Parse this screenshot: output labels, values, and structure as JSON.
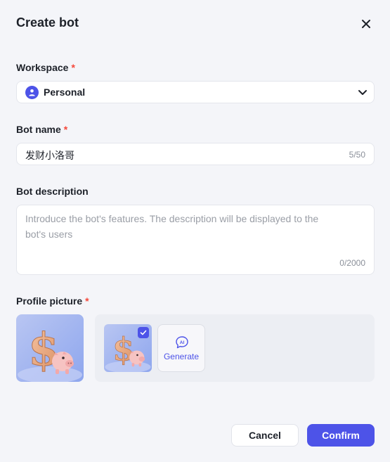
{
  "dialog": {
    "title": "Create bot",
    "close_icon": "close-icon"
  },
  "workspace": {
    "label": "Workspace",
    "required_mark": "*",
    "value": "Personal",
    "icon": "user-avatar-icon",
    "dropdown_icon": "chevron-down-icon"
  },
  "bot_name": {
    "label": "Bot name",
    "required_mark": "*",
    "value": "发财小洛哥",
    "counter": "5/50"
  },
  "bot_description": {
    "label": "Bot description",
    "placeholder": "Introduce the bot's features. The description will be displayed to the bot's users",
    "counter": "0/2000"
  },
  "profile_picture": {
    "label": "Profile picture",
    "required_mark": "*",
    "preview_image": "dollar-sign-piggy-bank-image",
    "option_image": "dollar-sign-piggy-bank-image",
    "selected_icon": "checkmark-icon",
    "generate_icon": "ai-sparkle-icon",
    "generate_label": "Generate"
  },
  "footer": {
    "cancel_label": "Cancel",
    "confirm_label": "Confirm"
  },
  "colors": {
    "accent": "#4d53e8",
    "required": "#f5483b",
    "background": "#f4f5f9"
  }
}
